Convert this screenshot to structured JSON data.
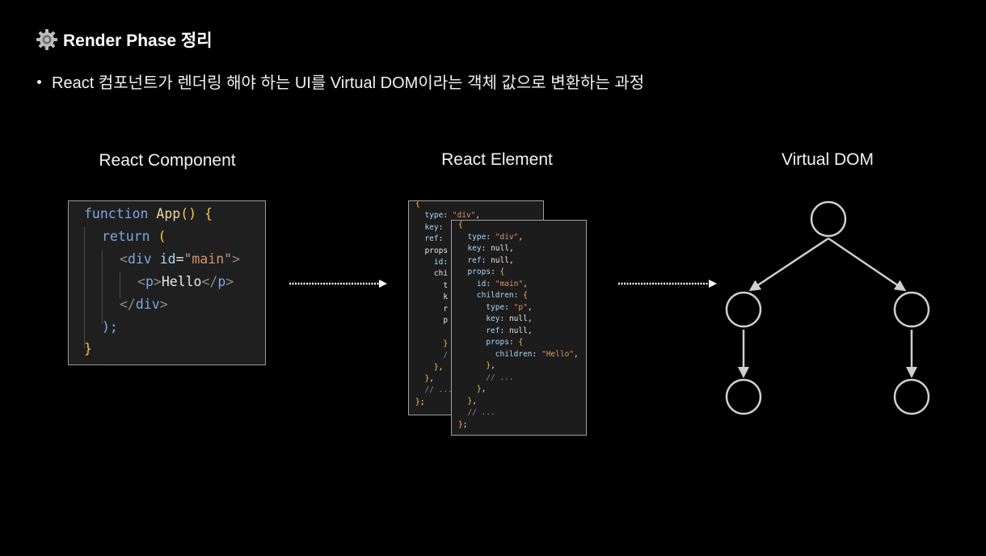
{
  "title": {
    "icon": "gear-icon",
    "text": "Render Phase 정리"
  },
  "bullet": {
    "text": "React 컴포넌트가 렌더링 해야 하는 UI를 Virtual DOM이라는 객체 값으로 변환하는 과정"
  },
  "columns": {
    "component": "React Component",
    "element": "React Element",
    "vdom": "Virtual DOM"
  },
  "component_code": {
    "line1": {
      "kw": "function",
      "name": " App",
      "paren": "() {"
    },
    "line2": {
      "kw": "return",
      "paren": " ("
    },
    "line3": {
      "open": "<",
      "tag": "div",
      "attr": " id",
      "eq": "=",
      "str": "\"main\"",
      "close": ">"
    },
    "line4": {
      "open": "<",
      "tag": "p",
      "close": ">",
      "text": "Hello",
      "endopen": "</",
      "endtag": "p",
      "endclose": ">"
    },
    "line5": {
      "open": "</",
      "tag": "div",
      "close": ">"
    },
    "line6": {
      "paren": ");"
    },
    "line7": {
      "paren": "}"
    }
  },
  "element_code": {
    "back": [
      "{",
      "  type: \"div\",",
      "  key:",
      "  ref:",
      "  props",
      "    id:",
      "    chi",
      "      t",
      "      k",
      "      r",
      "      p",
      "",
      "      }",
      "      /",
      "    },",
      "  },",
      "  // ...",
      "};"
    ],
    "front": [
      "{",
      "  type: \"div\",",
      "  key: null,",
      "  ref: null,",
      "  props: {",
      "    id: \"main\",",
      "    children: {",
      "      type: \"p\",",
      "      key: null,",
      "      ref: null,",
      "      props: {",
      "        children: \"Hello\",",
      "      },",
      "      // ...",
      "    },",
      "  },",
      "  // ...",
      "};"
    ]
  },
  "colors": {
    "background": "#000000",
    "arrow": "#ffffff",
    "tree": "#cfcfcf"
  }
}
